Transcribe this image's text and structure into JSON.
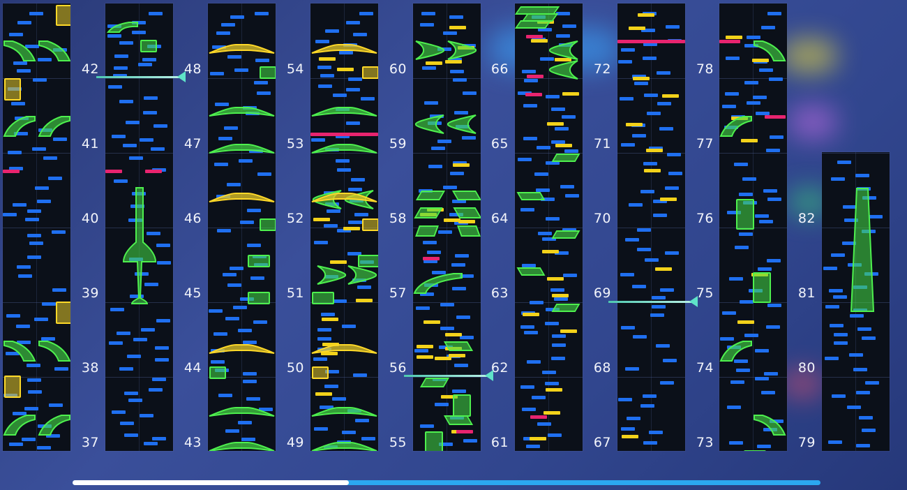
{
  "chart_view": {
    "measures_visible_from": 37,
    "measures_visible_to": 82,
    "columns": [
      {
        "labels": [
          "37",
          "38",
          "39",
          "40",
          "41",
          "42"
        ]
      },
      {
        "labels": [
          "43",
          "44",
          "45",
          "46",
          "47",
          "48"
        ]
      },
      {
        "labels": [
          "49",
          "50",
          "51",
          "52",
          "53",
          "54"
        ]
      },
      {
        "labels": [
          "55",
          "56",
          "57",
          "58",
          "59",
          "60"
        ]
      },
      {
        "labels": [
          "61",
          "62",
          "63",
          "64",
          "65",
          "66"
        ]
      },
      {
        "labels": [
          "67",
          "68",
          "69",
          "70",
          "71",
          "72"
        ]
      },
      {
        "labels": [
          "73",
          "74",
          "75",
          "76",
          "77",
          "78"
        ]
      },
      {
        "labels": [
          "79",
          "80",
          "81",
          "82"
        ]
      }
    ],
    "playhead_markers": [
      42,
      56,
      69
    ],
    "scroll_position": 0.37
  },
  "colors": {
    "tap": "#1f6ff0",
    "gold": "#f3d21a",
    "pink": "#e8246f",
    "hold": "#4ef04e",
    "lane_bg": "#0b1019",
    "scroll_track": "#2ba8f0",
    "scroll_thumb": "#ffffff"
  }
}
